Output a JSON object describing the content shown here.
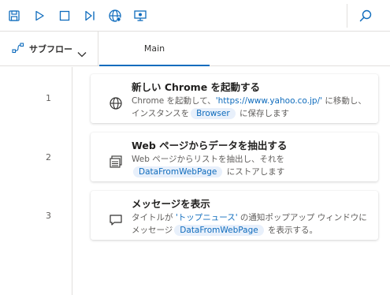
{
  "toolbar": {
    "icons": [
      "save-icon",
      "run-icon",
      "stop-icon",
      "step-icon",
      "web-recorder-icon",
      "desktop-recorder-icon",
      "search-icon"
    ]
  },
  "tabs": {
    "subflow_label": "サブフロー",
    "main_label": "Main"
  },
  "steps": [
    {
      "number": "1",
      "icon": "globe-icon",
      "title": "新しい Chrome を起動する",
      "desc_a": "Chrome を起動して、",
      "desc_url": "'https://www.yahoo.co.jp/'",
      "desc_b": " に移動し、インスタンスを",
      "chip": "Browser",
      "desc_c": " に保存します"
    },
    {
      "number": "2",
      "icon": "extract-icon",
      "title": "Web ページからデータを抽出する",
      "desc_a": "Web ページからリストを抽出し、それを",
      "chip": "DataFromWebPage",
      "desc_c": " にストアします"
    },
    {
      "number": "3",
      "icon": "message-icon",
      "title": "メッセージを表示",
      "desc_a": "タイトルが ",
      "desc_quote": "'トップニュース'",
      "desc_b": " の通知ポップアップ ウィンドウにメッセージ",
      "chip": "DataFromWebPage",
      "desc_c": " を表示する。"
    }
  ],
  "colors": {
    "accent": "#0f6cbd",
    "chip_bg": "#e8f0fb",
    "border": "#e1dfdd"
  }
}
